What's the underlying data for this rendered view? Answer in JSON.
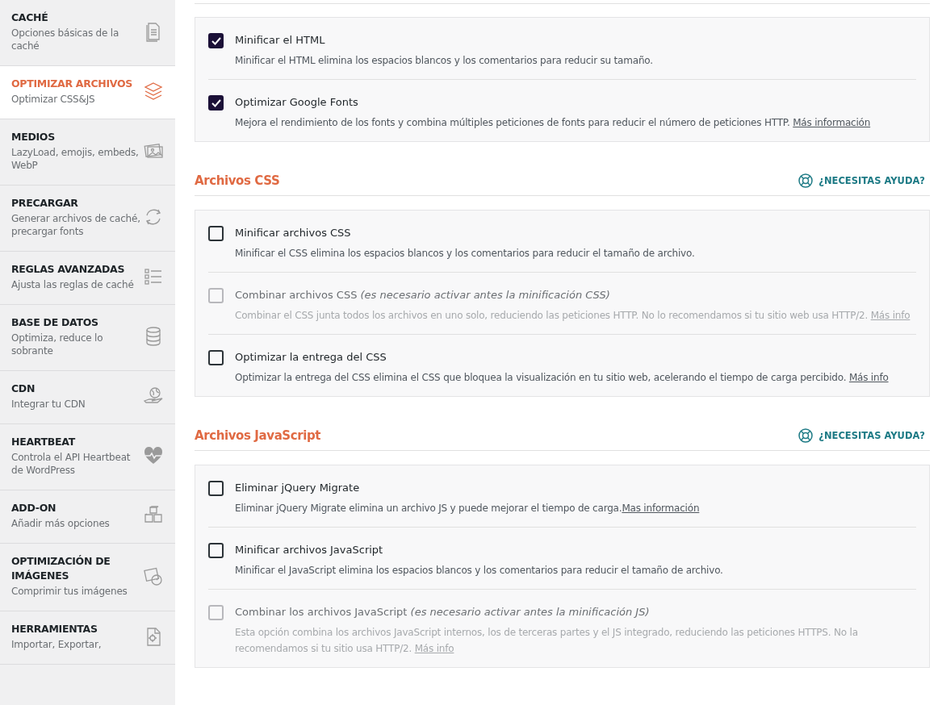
{
  "sidebar": {
    "items": [
      {
        "title": "CACHÉ",
        "subtitle": "Opciones básicas de la caché",
        "selected": false
      },
      {
        "title": "OPTIMIZAR ARCHIVOS",
        "subtitle": "Optimizar CSS&JS",
        "selected": true
      },
      {
        "title": "MEDIOS",
        "subtitle": "LazyLoad, emojis, embeds, WebP",
        "selected": false
      },
      {
        "title": "PRECARGAR",
        "subtitle": "Generar archivos de caché, precargar fonts",
        "selected": false
      },
      {
        "title": "REGLAS AVANZADAS",
        "subtitle": "Ajusta las reglas de caché",
        "selected": false
      },
      {
        "title": "BASE DE DATOS",
        "subtitle": "Optimiza, reduce lo sobrante",
        "selected": false
      },
      {
        "title": "CDN",
        "subtitle": "Integrar tu CDN",
        "selected": false
      },
      {
        "title": "HEARTBEAT",
        "subtitle": "Controla el API Heartbeat de WordPress",
        "selected": false
      },
      {
        "title": "ADD-ON",
        "subtitle": "Añadir más opciones",
        "selected": false
      },
      {
        "title": "OPTIMIZACIÓN DE IMÁGENES",
        "subtitle": "Comprimir tus imágenes",
        "selected": false
      },
      {
        "title": "HERRAMIENTAS",
        "subtitle": "Importar, Exportar,",
        "selected": false
      }
    ]
  },
  "sections": [
    {
      "options": [
        {
          "label": "Minificar el HTML",
          "description": "Minificar el HTML elimina los espacios blancos y los comentarios para reducir su tamaño.",
          "checked": true,
          "disabled": false
        },
        {
          "label": "Optimizar Google Fonts",
          "description": "Mejora el rendimiento de los fonts y combina múltiples peticiones de fonts para reducir el número de peticiones HTTP. ",
          "link": "Más información",
          "checked": true,
          "disabled": false
        }
      ]
    },
    {
      "title": "Archivos CSS",
      "help": "¿NECESITAS AYUDA?",
      "options": [
        {
          "label": "Minificar archivos CSS",
          "description": "Minificar el CSS elimina los espacios blancos y los comentarios para reducir el tamaño de archivo.",
          "checked": false,
          "disabled": false
        },
        {
          "label": "Combinar archivos CSS *(es necesario activar antes la minificación CSS)*",
          "description": "Combinar el CSS junta todos los archivos en uno solo, reduciendo las peticiones HTTP. No lo recomendamos si tu sitio web usa HTTP/2. ",
          "link": "Más info",
          "checked": false,
          "disabled": true
        },
        {
          "label": "Optimizar la entrega del CSS",
          "description": "Optimizar la entrega del CSS elimina el CSS que bloquea la visualización en tu sitio web, acelerando el tiempo de carga percibido. ",
          "link": "Más info",
          "checked": false,
          "disabled": false
        }
      ]
    },
    {
      "title": "Archivos JavaScript",
      "help": "¿NECESITAS AYUDA?",
      "options": [
        {
          "label": "Eliminar jQuery Migrate",
          "description": "Eliminar jQuery Migrate elimina un archivo JS y puede mejorar el tiempo de carga.",
          "link": "Mas información",
          "checked": false,
          "disabled": false
        },
        {
          "label": "Minificar archivos JavaScript",
          "description": "Minificar el JavaScript elimina los espacios blancos y los comentarios para reducir el tamaño de archivo.",
          "checked": false,
          "disabled": false
        },
        {
          "label": "Combinar los archivos JavaScript *(es necesario activar antes la minificación JS)*",
          "description": "Esta opción combina los archivos JavaScript internos, los de terceras partes y el JS integrado, reduciendo las peticiones HTTPS. No la recomendamos si tu sitio usa HTTP/2. ",
          "link": "Más info",
          "checked": false,
          "disabled": true
        }
      ]
    }
  ]
}
